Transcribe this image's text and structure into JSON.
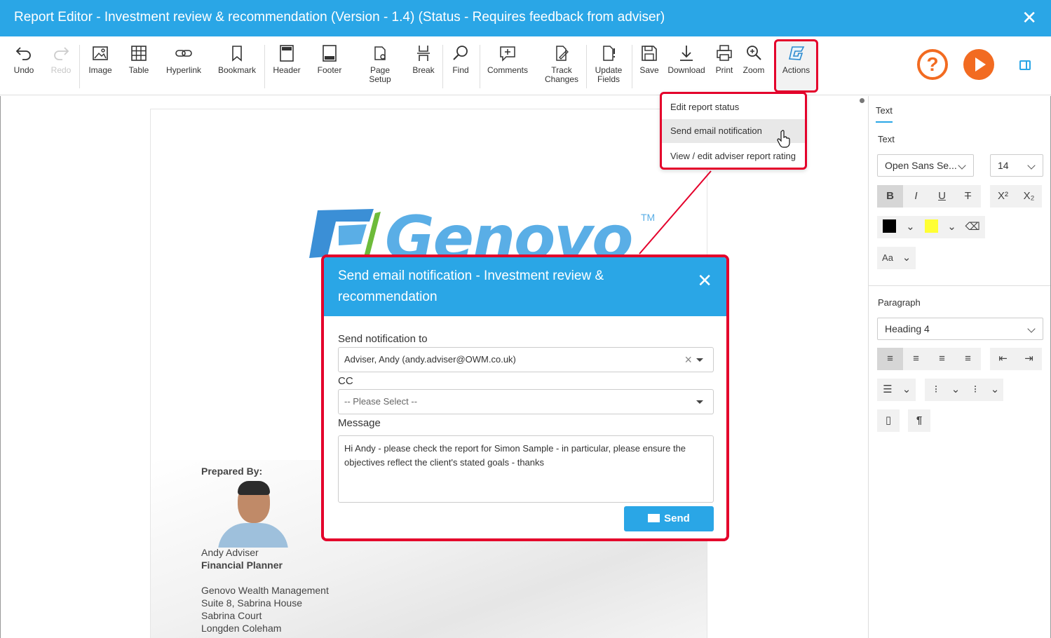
{
  "window": {
    "title": "Report Editor - Investment review & recommendation (Version - 1.4) (Status - Requires feedback from adviser)",
    "close": "✕"
  },
  "toolbar": {
    "undo": "Undo",
    "redo": "Redo",
    "image": "Image",
    "table": "Table",
    "hyperlink": "Hyperlink",
    "bookmark": "Bookmark",
    "header": "Header",
    "footer": "Footer",
    "page_setup_1": "Page",
    "page_setup_2": "Setup",
    "break": "Break",
    "find": "Find",
    "comments": "Comments",
    "track_1": "Track",
    "track_2": "Changes",
    "update_1": "Update",
    "update_2": "Fields",
    "save": "Save",
    "download": "Download",
    "print": "Print",
    "zoom": "Zoom",
    "actions": "Actions",
    "help": "?"
  },
  "actions_menu": {
    "items": [
      "Edit report status",
      "Send email notification",
      "View / edit adviser report rating"
    ]
  },
  "document": {
    "logo": "Genovo",
    "tm": "TM",
    "prepared_by": "Prepared By:",
    "name": "Andy Adviser",
    "role": "Financial Planner",
    "address": [
      "Genovo Wealth Management",
      "Suite 8, Sabrina House",
      "Sabrina Court",
      "Longden Coleham"
    ]
  },
  "side_panel": {
    "tab": "Text",
    "text_heading": "Text",
    "font": "Open Sans Se...",
    "size": "14",
    "format_buttons": [
      "B",
      "I",
      "U",
      "T",
      "X²",
      "X₂"
    ],
    "case": "Aa",
    "paragraph_heading": "Paragraph",
    "paragraph_style": "Heading 4",
    "colors": {
      "font": "#000000",
      "highlight": "#ffff33"
    }
  },
  "dialog": {
    "title": "Send email notification - Investment review & recommendation",
    "close": "✕",
    "to_label": "Send notification to",
    "to_value": "Adviser, Andy (andy.adviser@OWM.co.uk)",
    "cc_label": "CC",
    "cc_placeholder": "-- Please Select --",
    "message_label": "Message",
    "message": "Hi Andy - please check the report for Simon Sample - in particular, please ensure the objectives reflect the client's stated goals - thanks",
    "send": "Send"
  },
  "colors": {
    "accent": "#2aa6e6",
    "highlight_border": "#e4002b",
    "orange": "#f26b21"
  }
}
